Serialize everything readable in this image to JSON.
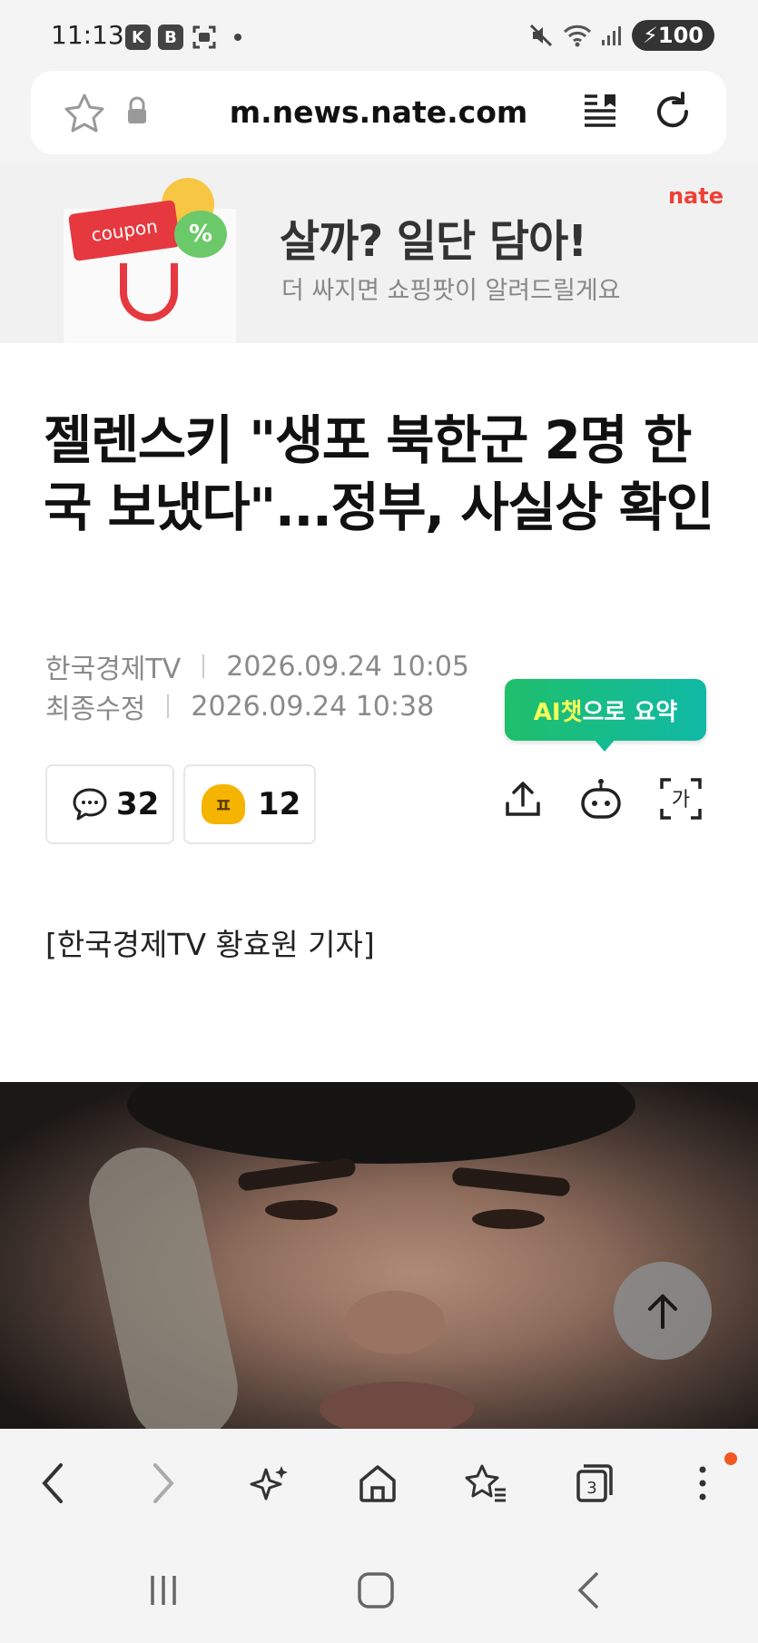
{
  "status_bar": {
    "time": "11:13",
    "left_badges": [
      "K",
      "B"
    ],
    "battery": "100"
  },
  "url_bar": {
    "url": "m.news.nate.com"
  },
  "ad": {
    "brand": "nate",
    "coupon_label": "coupon",
    "title": "살까? 일단 담아!",
    "subtitle": "더 싸지면 쇼핑팟이 알려드릴게요"
  },
  "article": {
    "headline": "젤렌스키 \"생포 북한군 2명 한국 보냈다\"...정부, 사실상 확인",
    "source": "한국경제TV",
    "published": "2026.09.24 10:05",
    "modified_label": "최종수정",
    "modified": "2026.09.24 10:38",
    "comment_count": "32",
    "emotion_count": "12",
    "byline": "[한국경제TV 황효원 기자]"
  },
  "ai_tooltip": {
    "prefix": "AI챗",
    "suffix": "으로 요약"
  },
  "bottom_bar": {
    "tab_count": "3"
  },
  "colors": {
    "accent_green": "#1fbf6b",
    "brand_red": "#ef4035",
    "notification": "#f05a22"
  }
}
